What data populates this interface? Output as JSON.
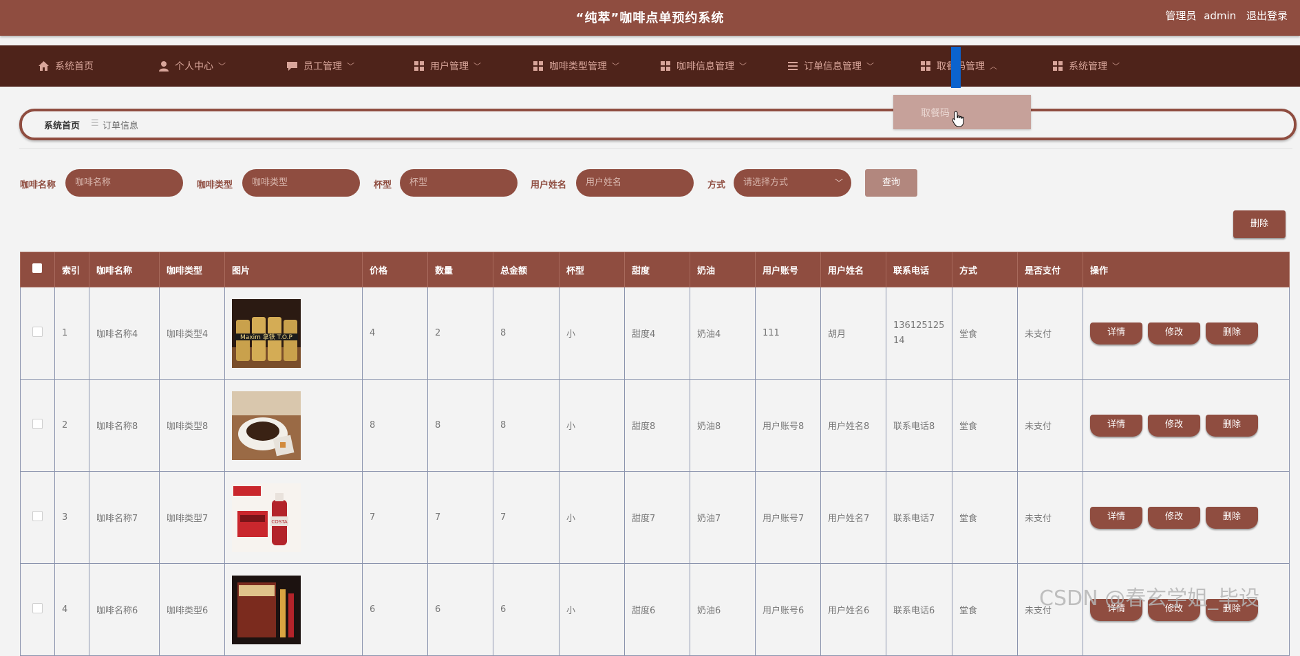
{
  "header": {
    "title": "“纯萃”咖啡点单预约系统",
    "role": "管理员",
    "username": "admin",
    "logout": "退出登录"
  },
  "nav": [
    {
      "label": "系统首页",
      "icon": "home-icon"
    },
    {
      "label": "个人中心",
      "icon": "user-icon"
    },
    {
      "label": "员工管理",
      "icon": "chat-icon"
    },
    {
      "label": "用户管理",
      "icon": "grid-icon"
    },
    {
      "label": "咖啡类型管理",
      "icon": "grid-icon"
    },
    {
      "label": "咖啡信息管理",
      "icon": "grid-icon"
    },
    {
      "label": "订单信息管理",
      "icon": "list-icon"
    },
    {
      "label": "取餐码管理",
      "icon": "grid-icon"
    },
    {
      "label": "系统管理",
      "icon": "grid-icon"
    }
  ],
  "dropdown": {
    "item": "取餐码"
  },
  "breadcrumb": {
    "home": "系统首页",
    "separator": "☰",
    "current": "订单信息"
  },
  "filters": {
    "coffee_name": {
      "label": "咖啡名称",
      "placeholder": "咖啡名称"
    },
    "coffee_type": {
      "label": "咖啡类型",
      "placeholder": "咖啡类型"
    },
    "cup": {
      "label": "杯型",
      "placeholder": "杯型"
    },
    "user_name": {
      "label": "用户姓名",
      "placeholder": "用户姓名"
    },
    "method": {
      "label": "方式",
      "placeholder": "请选择方式"
    },
    "query": "查询"
  },
  "delete_button": "删除",
  "table": {
    "headers": [
      "索引",
      "咖啡名称",
      "咖啡类型",
      "图片",
      "价格",
      "数量",
      "总金额",
      "杯型",
      "甜度",
      "奶油",
      "用户账号",
      "用户姓名",
      "联系电话",
      "方式",
      "是否支付",
      "操作"
    ],
    "actions": {
      "detail": "详情",
      "edit": "修改",
      "delete": "删除"
    },
    "rows": [
      {
        "index": "1",
        "name": "咖啡名称4",
        "type": "咖啡类型4",
        "price": "4",
        "qty": "2",
        "total": "8",
        "cup": "小",
        "sweet": "甜度4",
        "cream": "奶油4",
        "account": "111",
        "uname": "胡月",
        "phone": "13612512514",
        "method": "堂食",
        "paid": "未支付",
        "image": "bottles",
        "image_label": "Maxim 拿铁 T.O.P"
      },
      {
        "index": "2",
        "name": "咖啡名称8",
        "type": "咖啡类型8",
        "price": "8",
        "qty": "8",
        "total": "8",
        "cup": "小",
        "sweet": "甜度8",
        "cream": "奶油8",
        "account": "用户账号8",
        "uname": "用户姓名8",
        "phone": "联系电话8",
        "method": "堂食",
        "paid": "未支付",
        "image": "cup"
      },
      {
        "index": "3",
        "name": "咖啡名称7",
        "type": "咖啡类型7",
        "price": "7",
        "qty": "7",
        "total": "7",
        "cup": "小",
        "sweet": "甜度7",
        "cream": "奶油7",
        "account": "用户账号7",
        "uname": "用户姓名7",
        "phone": "联系电话7",
        "method": "堂食",
        "paid": "未支付",
        "image": "costa",
        "image_label": "COSTA"
      },
      {
        "index": "4",
        "name": "咖啡名称6",
        "type": "咖啡类型6",
        "price": "6",
        "qty": "6",
        "total": "6",
        "cup": "小",
        "sweet": "甜度6",
        "cream": "奶油6",
        "account": "用户账号6",
        "uname": "用户姓名6",
        "phone": "联系电话6",
        "method": "堂食",
        "paid": "未支付",
        "image": "box"
      }
    ]
  },
  "watermark": "CSDN @春玄学姐_毕设",
  "colors": {
    "primary": "#8f4d40",
    "nav_bg": "#4e231a",
    "page_bg": "#f3f3f3",
    "active_marker": "#0b63ce"
  }
}
